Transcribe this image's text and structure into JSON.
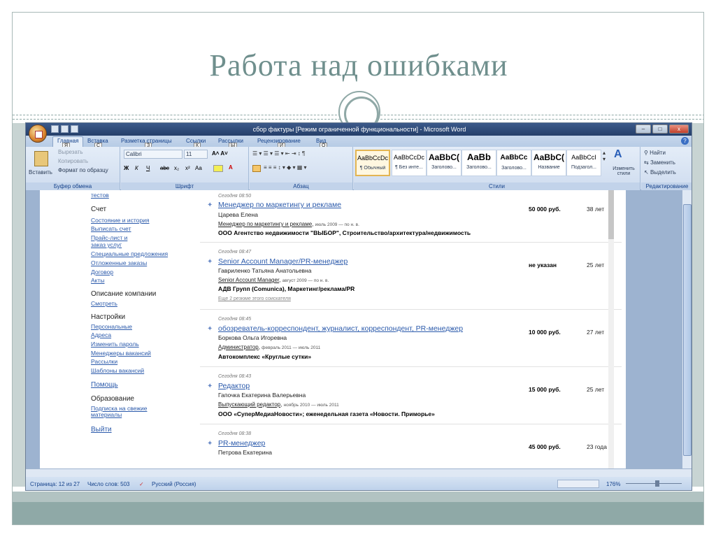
{
  "slide": {
    "title": "Работа над ошибками"
  },
  "window": {
    "title": "сбор фактуры [Режим ограниченной функциональности] - Microsoft Word",
    "controls": [
      "–",
      "□",
      "x"
    ]
  },
  "ribbon": {
    "tabs": [
      {
        "label": "Главная",
        "key": "Я"
      },
      {
        "label": "Вставка",
        "key": "С"
      },
      {
        "label": "Разметка страницы",
        "key": "З"
      },
      {
        "label": "Ссылки",
        "key": "К"
      },
      {
        "label": "Рассылки",
        "key": "Ы"
      },
      {
        "label": "Рецензирование",
        "key": "И"
      },
      {
        "label": "Вид",
        "key": "О"
      }
    ],
    "clipboard": {
      "paste": "Вставить",
      "cut": "Вырезать",
      "copy": "Копировать",
      "format": "Формат по образцу",
      "label": "Буфер обмена"
    },
    "font": {
      "name": "Calibri",
      "size": "11",
      "label": "Шрифт"
    },
    "paragraph": {
      "label": "Абзац"
    },
    "styles": {
      "label": "Стили",
      "items": [
        {
          "sample": "AaBbCcDc",
          "name": "¶ Обычный"
        },
        {
          "sample": "AaBbCcDc",
          "name": "¶ Без инте..."
        },
        {
          "sample": "AaBbC(",
          "name": "Заголово..."
        },
        {
          "sample": "AaBb",
          "name": "Заголово..."
        },
        {
          "sample": "AaBbCc",
          "name": "Заголово..."
        },
        {
          "sample": "AaBbC(",
          "name": "Название"
        },
        {
          "sample": "AaBbCcI",
          "name": "Подзагол..."
        }
      ],
      "change": "Изменить стили"
    },
    "editing": {
      "find": "Найти",
      "replace": "Заменить",
      "select": "Выделить",
      "label": "Редактирование"
    }
  },
  "leftnav": {
    "top_link": "тестов",
    "sections": [
      {
        "heading": "Счет",
        "links": [
          "Состояние и история",
          "Выписать счет",
          "Прайс-лист и",
          "заказ услуг",
          "Специальные предложения",
          "Отложенные заказы",
          "Договор",
          "Акты"
        ]
      },
      {
        "heading": "Описание компании",
        "links": [
          "Смотреть"
        ]
      },
      {
        "heading": "Настройки",
        "links": [
          "Персональные",
          "Адреса",
          "Изменить пароль",
          "Менеджеры вакансий",
          "Рассылки",
          "Шаблоны вакансий"
        ]
      }
    ],
    "help": "Помощь",
    "education": {
      "heading": "Образование",
      "links": [
        "Подписка на свежие",
        "материалы"
      ]
    },
    "logout": "Выйти"
  },
  "results": [
    {
      "time": "Сегодня 08:50",
      "title": "Менеджер по маркетингу и рекламе",
      "name": "Царева Елена",
      "position": "Менеджер по маркетингу и рекламе",
      "dates": "июль 2009 — по н. в.",
      "company": "ООО Агентство недвижимости \"ВЫБОР\", Строительство/архитектура/недвижимость",
      "more": "",
      "salary": "50 000 руб.",
      "age": "38 лет"
    },
    {
      "time": "Сегодня 08:47",
      "title": "Senior Account Manager/PR-менеджер",
      "name": "Гавриленко Татьяна Анатольевна",
      "position": "Senior Account Manager",
      "dates": "август 2009 — по н. в.",
      "company": "АДВ Групп (Comunica), Маркетинг/реклама/PR",
      "more": "Еще 2 резюме этого соискателя",
      "salary": "не указан",
      "age": "25 лет"
    },
    {
      "time": "Сегодня 08:45",
      "title": "обозреватель-корреспондент, журналист, корреспондент, PR-менеджер",
      "name": "Боркова Ольга Игоревна",
      "position": "Администратор",
      "dates": "февраль 2011 — июль 2011",
      "company": "Автокомплекс «Круглые сутки»",
      "more": "",
      "salary": "10 000 руб.",
      "age": "27 лет"
    },
    {
      "time": "Сегодня 08:43",
      "title": "Редактор",
      "name": "Гапочка Екатерина Валерьевна",
      "position": "Выпускающий редактор",
      "dates": "ноябрь 2010 — июль 2011",
      "company": "ООО «СуперМедиаНовости»; еженедельная газета «Новости. Приморье»",
      "more": "",
      "salary": "15 000 руб.",
      "age": "25 лет"
    },
    {
      "time": "Сегодня 08:38",
      "title": "PR-менеджер",
      "name": "Петрова Екатерина",
      "position": "",
      "dates": "",
      "company": "",
      "more": "",
      "salary": "45 000 руб.",
      "age": "23 года"
    }
  ],
  "statusbar": {
    "page": "Страница: 12 из 27",
    "words": "Число слов: 503",
    "lang": "Русский (Россия)",
    "zoom": "176%"
  }
}
